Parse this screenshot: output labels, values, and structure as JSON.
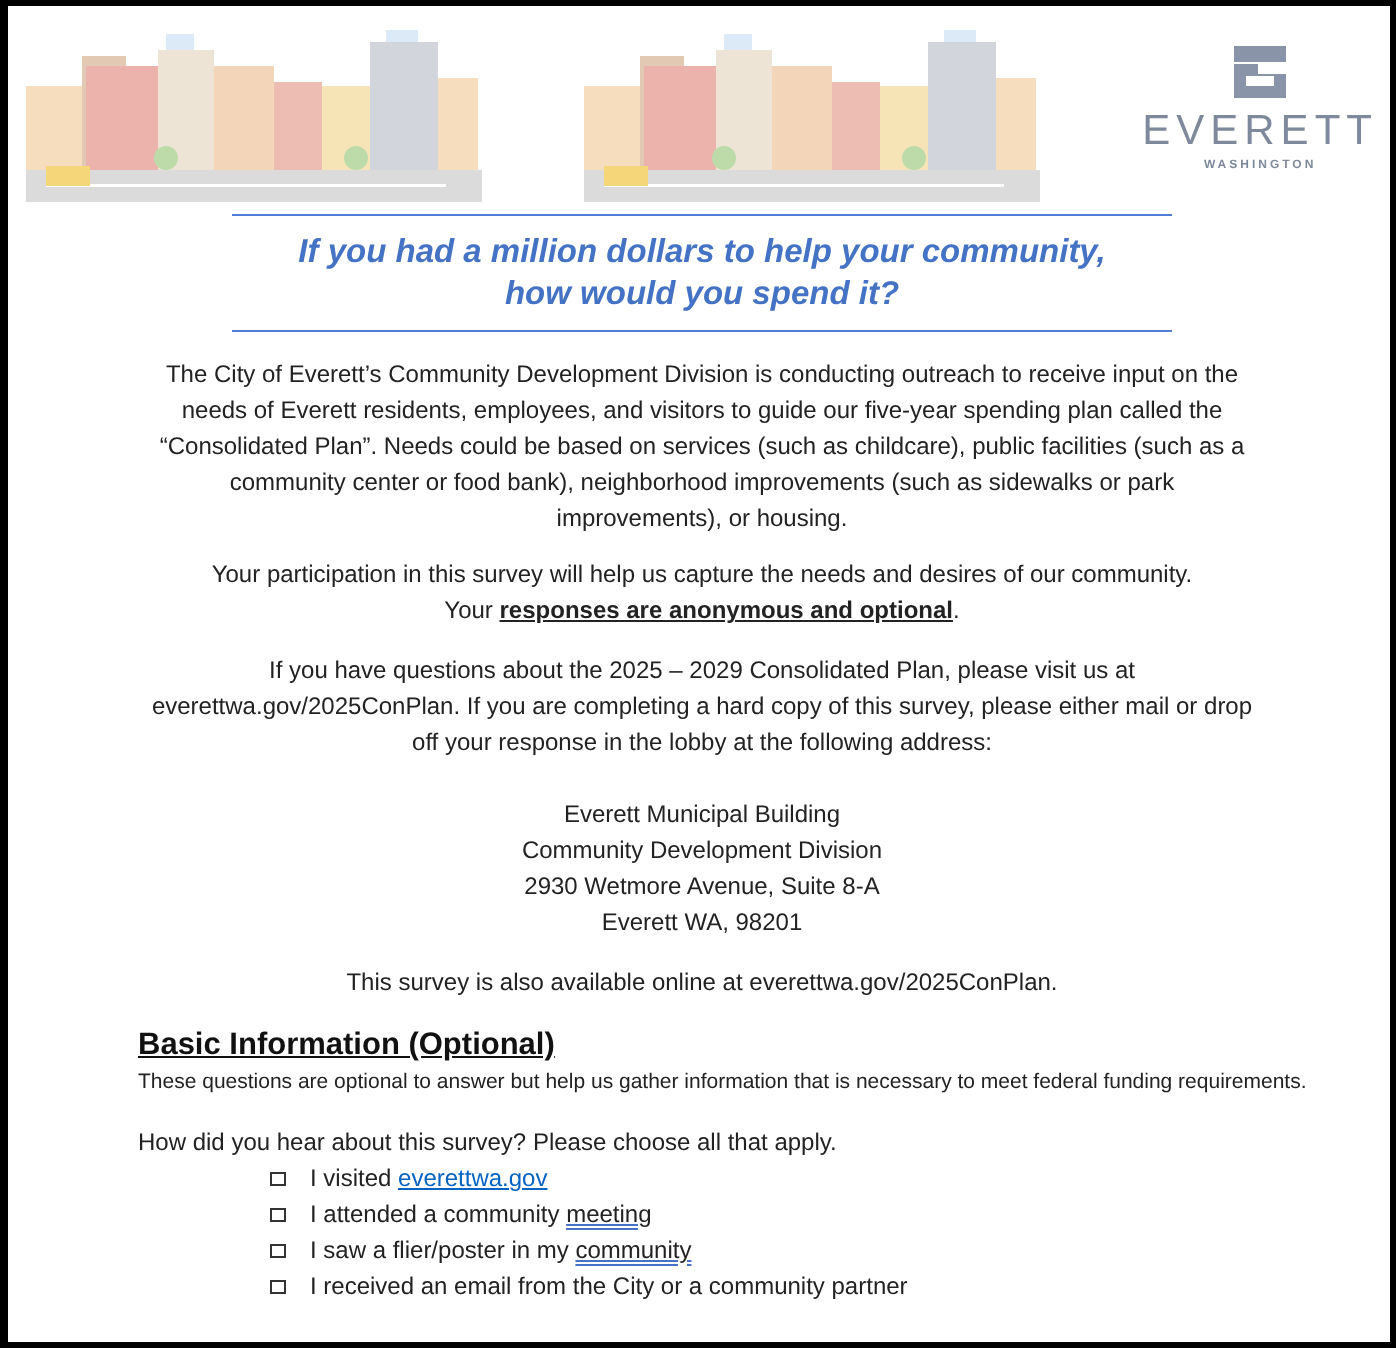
{
  "logo": {
    "name": "EVERETT",
    "subtitle": "WASHINGTON"
  },
  "headline": [
    "If you had a million dollars to help your community,",
    "how would you spend it?"
  ],
  "intro": "The City of Everett’s Community Development Division is conducting outreach to receive input on the needs of Everett residents, employees, and visitors to guide our five-year spending plan called the “Consolidated Plan”. Needs could be based on services (such as childcare), public facilities (such as a community center or food bank), neighborhood improvements (such as sidewalks or park improvements), or housing.",
  "participation": [
    "Your participation in this survey will help us capture the needs and desires of our community.",
    "Your **responses are anonymous and optional**."
  ],
  "questions_paragraph": "If you have questions about the 2025 – 2029 Consolidated Plan, please visit us at everettwa.gov/2025ConPlan. If you are completing a hard copy of this survey, please either mail or drop off your response in the lobby at the following address:",
  "address": [
    "Everett Municipal Building",
    "Community Development Division",
    "2930 Wetmore Avenue, Suite 8-A",
    "Everett WA, 98201"
  ],
  "online_note": "This survey is also available online at everettwa.gov/2025ConPlan.",
  "section": {
    "title": "Basic Information (Optional)",
    "description": "These questions are optional to answer but help us gather information that is necessary to meet federal funding requirements.",
    "question": "How did you hear about this survey? Please choose all that apply.",
    "options": [
      {
        "text": "I visited ",
        "marked": "everettwa.gov",
        "kind": "link",
        "checked": false
      },
      {
        "text": "I attended a community ",
        "marked": "meeting",
        "kind": "proofing",
        "checked": false
      },
      {
        "text": "I saw a flier/poster in my ",
        "marked": "community",
        "kind": "proofing",
        "checked": false
      },
      {
        "text": "I received an email from the City or a community partner",
        "checked": false
      }
    ]
  }
}
